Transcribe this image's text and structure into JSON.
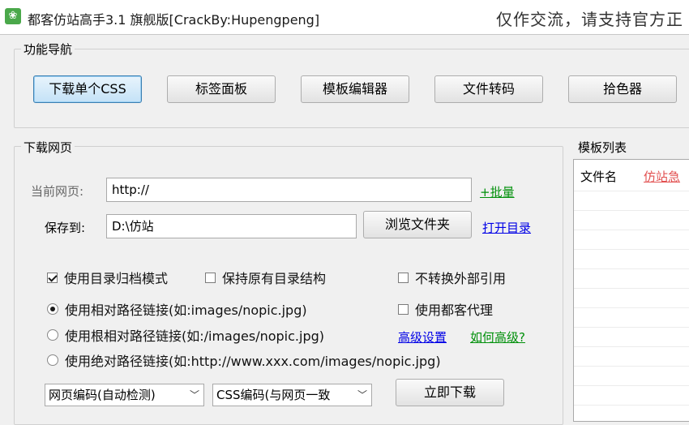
{
  "window": {
    "title": "都客仿站高手3.1 旗舰版[CrackBy:Hupengpeng]",
    "banner": "仅作交流，请支持官方正"
  },
  "nav": {
    "label": "功能导航",
    "buttons": [
      "下载单个CSS",
      "标签面板",
      "模板编辑器",
      "文件转码",
      "拾色器"
    ]
  },
  "download": {
    "label": "下载网页",
    "url_label": "当前网页:",
    "url_value": "http://",
    "batch_link": "+批量",
    "save_label": "保存到:",
    "save_value": "D:\\仿站",
    "browse_button": "浏览文件夹",
    "open_dir_link": "打开目录",
    "options": {
      "archive_mode": "使用目录归档模式",
      "keep_structure": "保持原有目录结构",
      "no_convert_external": "不转换外部引用",
      "relative_link": "使用相对路径链接(如:images/nopic.jpg)",
      "use_proxy": "使用都客代理",
      "root_relative_link": "使用根相对路径链接(如:/images/nopic.jpg)",
      "absolute_link": "使用绝对路径链接(如:http://www.xxx.com/images/nopic.jpg)"
    },
    "advanced_link": "高级设置",
    "how_advanced_link": "如何高级?",
    "page_encoding": "网页编码(自动检测)",
    "css_encoding": "CSS编码(与网页一致",
    "download_button": "立即下载"
  },
  "templates": {
    "label": "模板列表",
    "col_filename": "文件名",
    "col_link": "仿站急"
  }
}
